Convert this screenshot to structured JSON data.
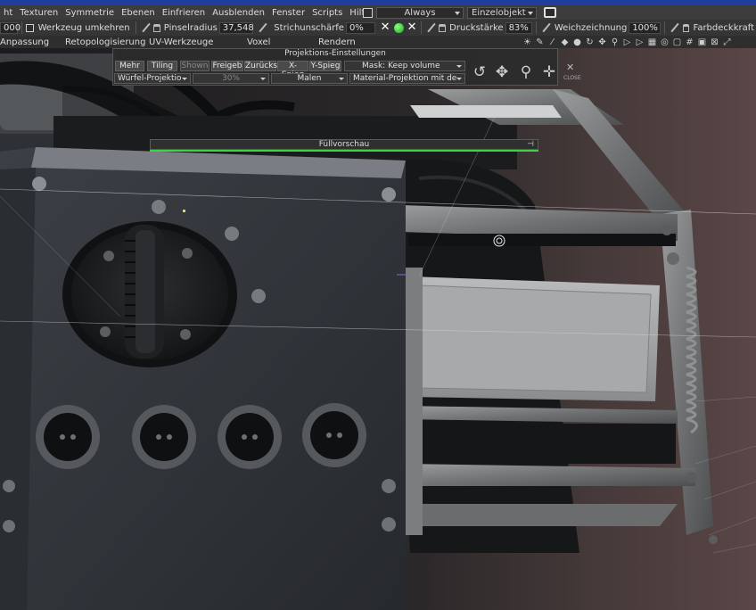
{
  "menubar": {
    "items": [
      "ht",
      "Texturen",
      "Symmetrie",
      "Ebenen",
      "Einfrieren",
      "Ausblenden",
      "Fenster",
      "Scripts",
      "Hilfe"
    ],
    "always_value": "Always",
    "einzelobjekt_value": "Einzelobjekt"
  },
  "toolbar": {
    "size_value": "000",
    "werkzeug_label": "Werkzeug umkehren",
    "pinselradius_label": "Pinselradius",
    "pinselradius_value": "37,548",
    "strichunschaerfe_label": "Strichunschärfe",
    "strichunschaerfe_value": "0%",
    "druckstaerke_label": "Druckstärke",
    "druckstaerke_value": "83%",
    "weichzeichnung_label": "Weichzeichnung",
    "weichzeichnung_value": "100%",
    "farbdeckkraft_label": "Farbdeckkraft"
  },
  "tabs": [
    "Anpassung",
    "Retopologisierung",
    "UV-Werkzeuge",
    "Voxel",
    "Rendern"
  ],
  "projection_panel": {
    "title": "Projektions-Einstellungen",
    "buttons": [
      "Mehr",
      "Tiling",
      "Shown",
      "Freigeb",
      "Zurücks",
      "X-Spieg",
      "Y-Spieg"
    ],
    "mask_value": "Mask: Keep volume",
    "cube_projection_value": "Würfel-Projektio",
    "percent_value": "30%",
    "paint_value": "Malen",
    "material_projection_value": "Material-Projektion mit de",
    "close_label": "CLOSE"
  },
  "fill_preview": {
    "label": "Füllvorschau",
    "pin": "⊣"
  },
  "icons": {
    "reset": "reset-icon",
    "move": "move-icon",
    "zoom": "zoom-icon",
    "pan": "pan-icon",
    "close": "close-icon"
  },
  "colors": {
    "accent_green": "#3ad640",
    "titlebar_blue": "#1f3fa0"
  }
}
